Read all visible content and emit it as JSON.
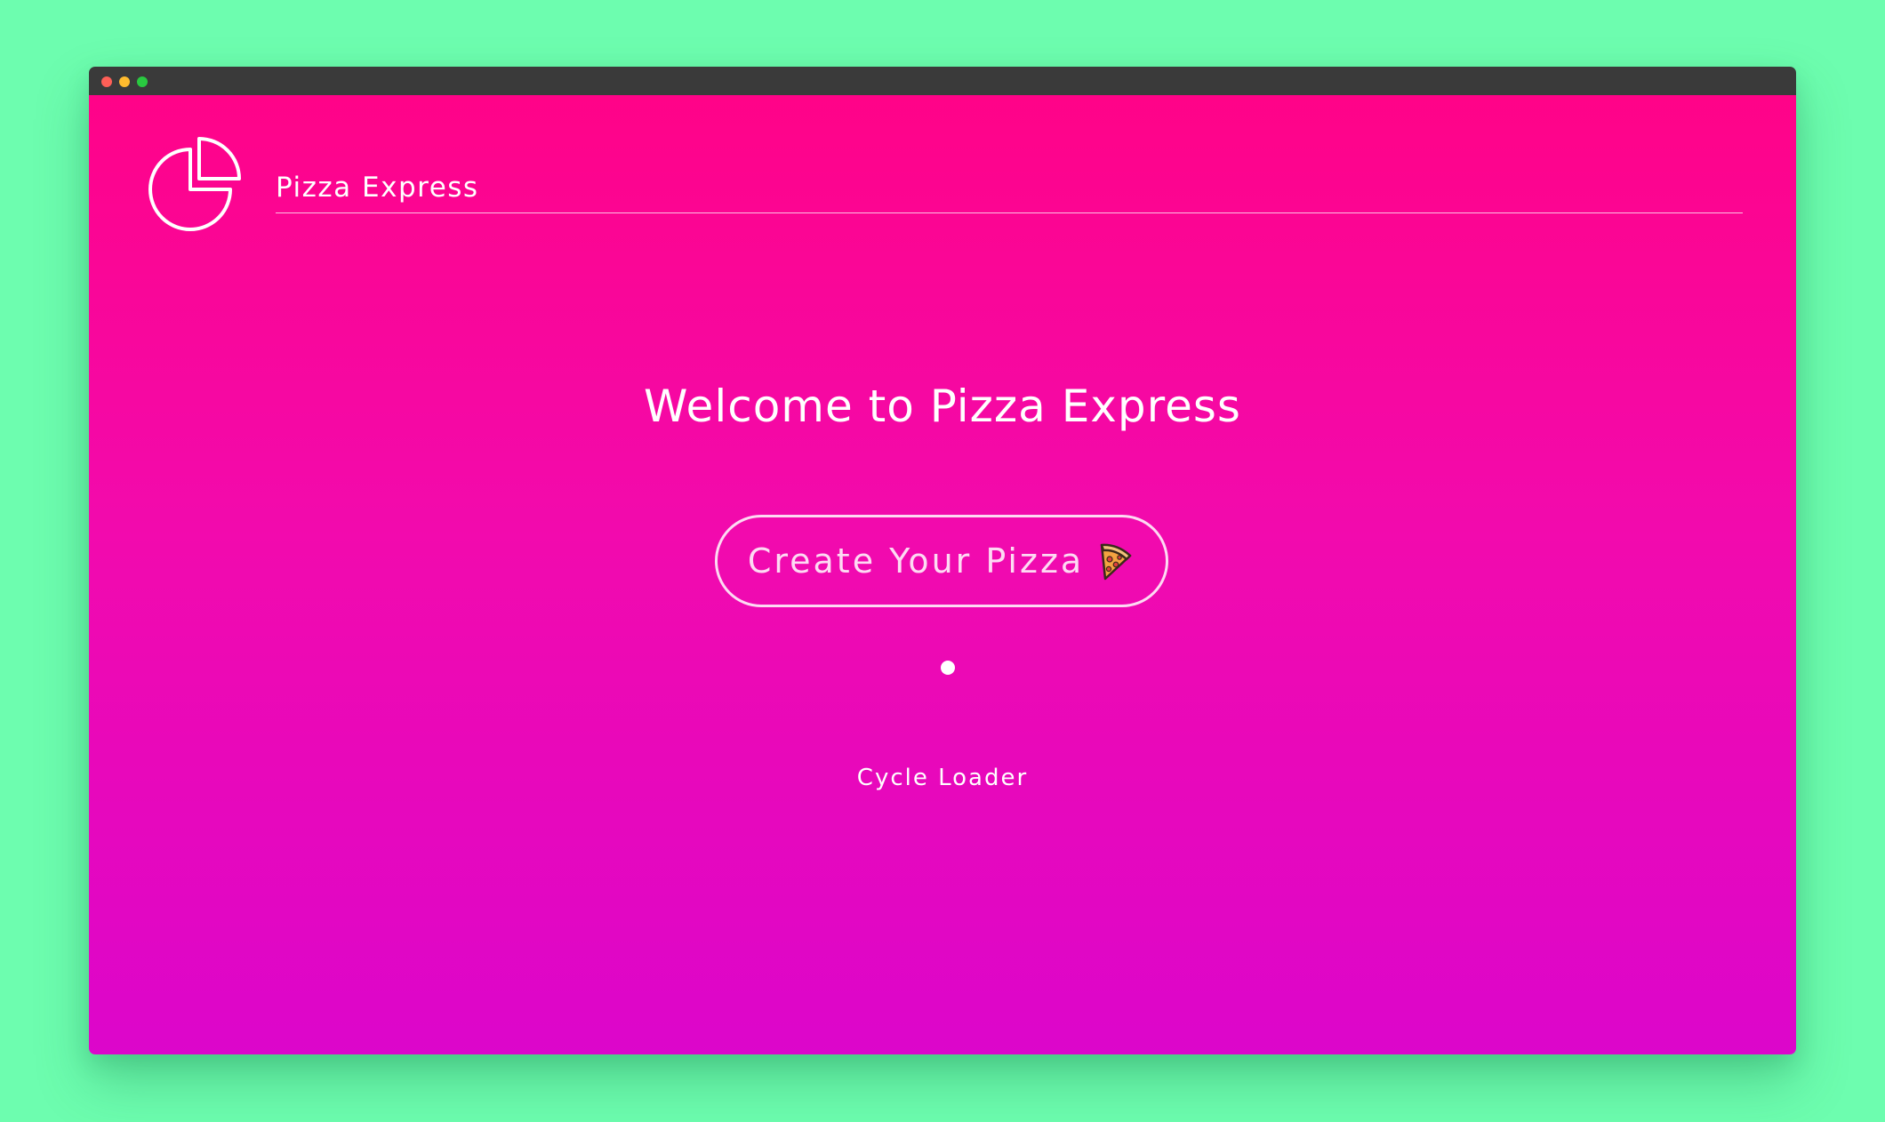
{
  "colors": {
    "desktop_background": "#6dfdaf",
    "titlebar": "#3a3a3a",
    "traffic_close": "#fe5f57",
    "traffic_minimize": "#febb2e",
    "traffic_maximize": "#29c940",
    "gradient_top": "#ff0388",
    "gradient_bottom": "#dc06cb",
    "text": "#ffffff"
  },
  "header": {
    "logo_icon": "pie-chart-icon",
    "brand": "Pizza Express"
  },
  "main": {
    "welcome": "Welcome to Pizza Express",
    "cta_label": "Create Your Pizza",
    "cta_icon": "pizza-slice-icon",
    "loader_label": "Cycle Loader"
  }
}
